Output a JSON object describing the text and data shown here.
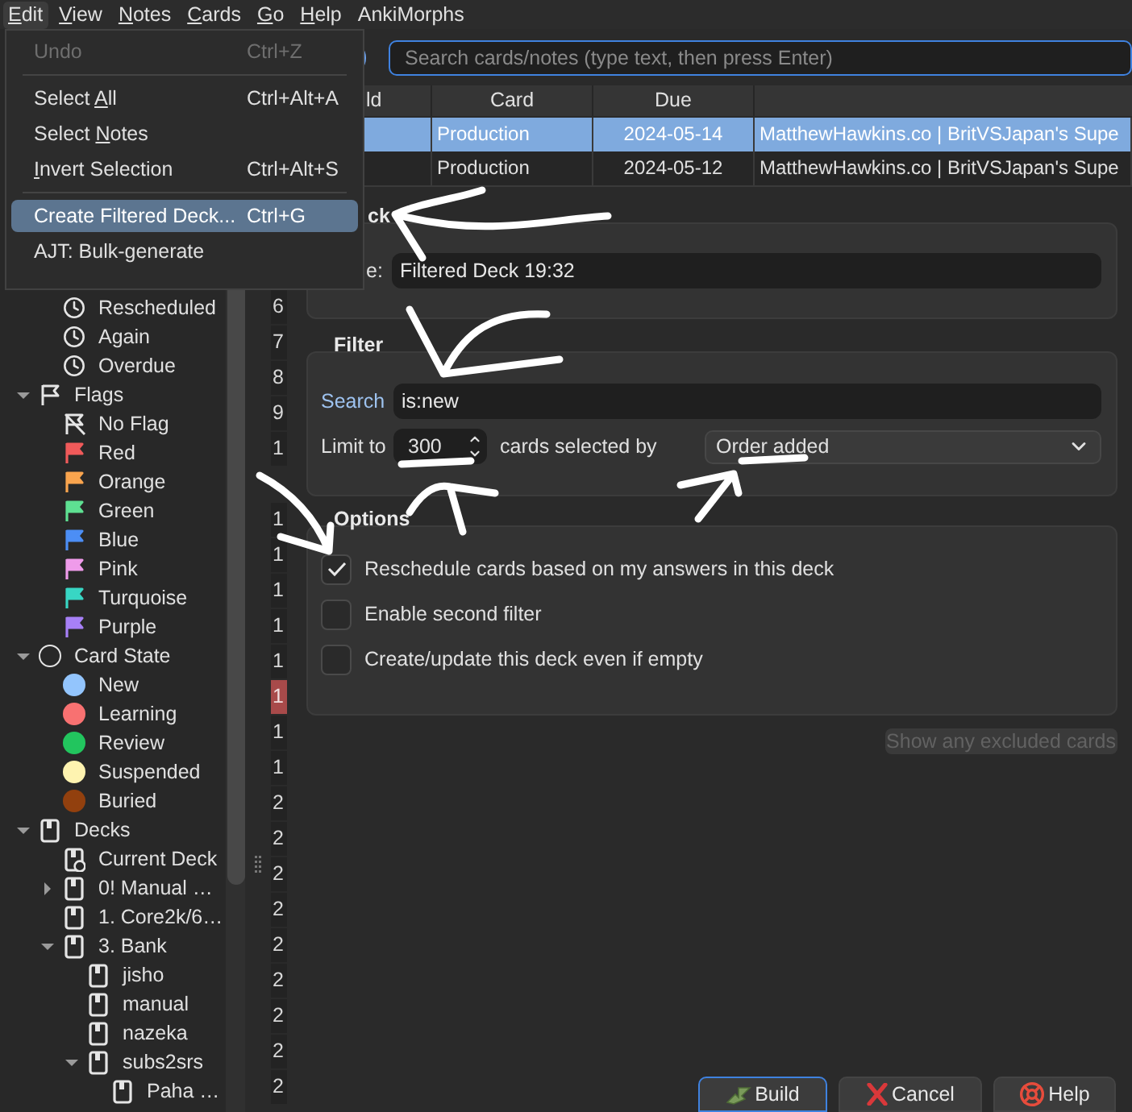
{
  "menu_bar": [
    {
      "key": "E",
      "after": "dit",
      "selected": true
    },
    {
      "key": "V",
      "after": "iew",
      "selected": false
    },
    {
      "key": "N",
      "after": "otes",
      "selected": false
    },
    {
      "key": "C",
      "after": "ards",
      "selected": false
    },
    {
      "key": "G",
      "after": "o",
      "selected": false
    },
    {
      "key": "H",
      "after": "elp",
      "selected": false
    },
    {
      "after": "AnkiMorphs",
      "selected": false
    }
  ],
  "edit_menu": [
    {
      "kind": "item",
      "after": "Undo",
      "shortcut": "Ctrl+Z",
      "disabled": true,
      "selected": false
    },
    {
      "kind": "separator"
    },
    {
      "kind": "item",
      "before": "Select ",
      "key": "A",
      "after": "ll",
      "shortcut": "Ctrl+Alt+A",
      "disabled": false,
      "selected": false
    },
    {
      "kind": "item",
      "before": "Select ",
      "key": "N",
      "after": "otes",
      "disabled": false,
      "selected": false
    },
    {
      "kind": "item",
      "key": "I",
      "after": "nvert Selection",
      "shortcut": "Ctrl+Alt+S",
      "disabled": false,
      "selected": false
    },
    {
      "kind": "separator"
    },
    {
      "kind": "item",
      "after": "Create Filtered Deck...",
      "shortcut": "Ctrl+G",
      "disabled": false,
      "selected": true
    },
    {
      "kind": "item",
      "after": "AJT: Bulk-generate",
      "disabled": false,
      "selected": false
    }
  ],
  "sidebar": {
    "partial_items": [
      {
        "label": "Rescheduled",
        "kind": "clock"
      },
      {
        "label": "Again",
        "kind": "clock"
      },
      {
        "label": "Overdue",
        "kind": "clock"
      }
    ],
    "tree": [
      {
        "label": "Flags",
        "kind": "flag-outline",
        "expanded": true,
        "children": [
          {
            "label": "No Flag",
            "kind": "no-flag"
          },
          {
            "label": "Red",
            "kind": "flag",
            "color": "#f05a5a"
          },
          {
            "label": "Orange",
            "kind": "flag",
            "color": "#f9a44e"
          },
          {
            "label": "Green",
            "kind": "flag",
            "color": "#5ee092"
          },
          {
            "label": "Blue",
            "kind": "flag",
            "color": "#4c8ef5"
          },
          {
            "label": "Pink",
            "kind": "flag",
            "color": "#ef9bea"
          },
          {
            "label": "Turquoise",
            "kind": "flag",
            "color": "#38d6c4"
          },
          {
            "label": "Purple",
            "kind": "flag",
            "color": "#a780f7"
          }
        ]
      },
      {
        "label": "Card State",
        "kind": "circle-outline",
        "expanded": true,
        "children": [
          {
            "label": "New",
            "kind": "state",
            "color": "#93c5fd"
          },
          {
            "label": "Learning",
            "kind": "state",
            "color": "#f87171"
          },
          {
            "label": "Review",
            "kind": "state",
            "color": "#22c55e"
          },
          {
            "label": "Suspended",
            "kind": "state",
            "color": "#fef3b0"
          },
          {
            "label": "Buried",
            "kind": "state",
            "color": "#92400e"
          }
        ]
      },
      {
        "label": "Decks",
        "kind": "deck",
        "expanded": true,
        "children": [
          {
            "label": "Current Deck",
            "kind": "current-deck"
          },
          {
            "label": "0! Manual …",
            "kind": "deck",
            "expanded": false
          },
          {
            "label": "1. Core2k/6…",
            "kind": "deck"
          },
          {
            "label": "3. Bank",
            "kind": "deck",
            "expanded": true,
            "children": [
              {
                "label": "jisho",
                "kind": "deck"
              },
              {
                "label": "manual",
                "kind": "deck"
              },
              {
                "label": "nazeka",
                "kind": "deck"
              },
              {
                "label": "subs2srs",
                "kind": "deck",
                "expanded": true,
                "children": [
                  {
                    "label": "Paha …",
                    "kind": "deck"
                  }
                ]
              }
            ]
          }
        ]
      }
    ]
  },
  "search": {
    "placeholder": "Search cards/notes (type text, then press Enter)"
  },
  "table": {
    "columns": [
      "ld",
      "Card",
      "Due"
    ],
    "rows": [
      {
        "selected": true,
        "cells": [
          "",
          "Production",
          "2024-05-14",
          "MatthewHawkins.co | BritVSJapan's Supe"
        ]
      },
      {
        "selected": false,
        "cells": [
          "",
          "Production",
          "2024-05-12",
          "MatthewHawkins.co | BritVSJapan's Supe"
        ]
      }
    ]
  },
  "number_column": {
    "upper": [
      {
        "text": "6",
        "marked": false
      },
      {
        "text": "7",
        "marked": false
      },
      {
        "text": "8",
        "marked": false
      },
      {
        "text": "9",
        "marked": false
      },
      {
        "text": "1",
        "marked": false
      }
    ],
    "lower": [
      {
        "text": "1",
        "marked": false
      },
      {
        "text": "1",
        "marked": false
      },
      {
        "text": "1",
        "marked": false
      },
      {
        "text": "1",
        "marked": false
      },
      {
        "text": "1",
        "marked": false
      },
      {
        "text": "1",
        "marked": true
      },
      {
        "text": "1",
        "marked": false
      },
      {
        "text": "1",
        "marked": false
      },
      {
        "text": "2",
        "marked": false
      },
      {
        "text": "2",
        "marked": false
      },
      {
        "text": "2",
        "marked": false
      },
      {
        "text": "2",
        "marked": false
      },
      {
        "text": "2",
        "marked": false
      },
      {
        "text": "2",
        "marked": false
      },
      {
        "text": "2",
        "marked": false
      },
      {
        "text": "2",
        "marked": false
      },
      {
        "text": "2",
        "marked": false
      }
    ]
  },
  "dialog": {
    "deck_group": {
      "title": "ck",
      "name_label": "e:",
      "name_value": "Filtered Deck 19:32"
    },
    "filter_group": {
      "title": "Filter",
      "search_label": "Search",
      "search_value": "is:new",
      "limit_label": "Limit to",
      "limit_value": "300",
      "selected_by_label": "cards selected by",
      "order": "Order added"
    },
    "options_group": {
      "title": "Options",
      "checkboxes": [
        {
          "label": "Reschedule cards based on my answers in this deck",
          "checked": true
        },
        {
          "label": "Enable second filter",
          "checked": false
        },
        {
          "label": "Create/update this deck even if empty",
          "checked": false
        }
      ]
    },
    "excluded_button": {
      "label": "Show any excluded cards",
      "disabled": true
    },
    "buttons": [
      {
        "kind": "build",
        "label": "Build",
        "default": true
      },
      {
        "kind": "cancel",
        "label": "Cancel",
        "default": false
      },
      {
        "kind": "help",
        "label": "Help",
        "default": false
      }
    ]
  }
}
